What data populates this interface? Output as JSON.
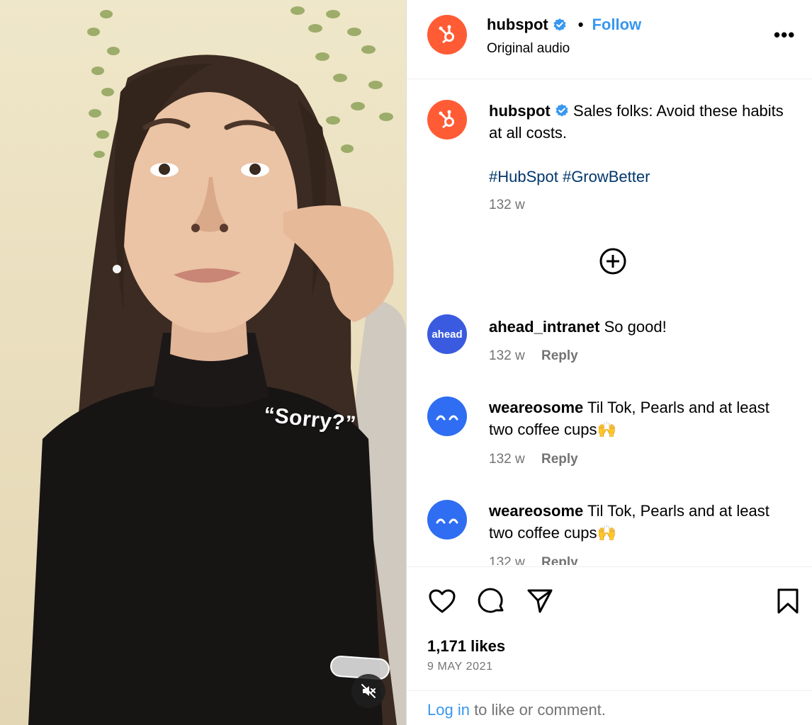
{
  "video": {
    "caption": "“Sorry?”",
    "mute_icon": "speaker-muted-icon"
  },
  "header": {
    "username": "hubspot",
    "verified_icon": "verified-badge-icon",
    "separator": "•",
    "follow_label": "Follow",
    "audio": "Original audio",
    "more_icon": "more-options-icon",
    "more_glyph": "•••"
  },
  "post": {
    "username": "hubspot",
    "caption": "Sales folks: Avoid these habits at all costs.",
    "hashtags": "#HubSpot #GrowBetter",
    "age": "132 w"
  },
  "load_more_icon": "plus-circle-icon",
  "comments": [
    {
      "username": "ahead_intranet",
      "avatar_text": "ahead",
      "text": "So good!",
      "age": "132 w",
      "reply": "Reply"
    },
    {
      "username": "weareosome",
      "text": "Til Tok, Pearls and at least two coffee cups🙌",
      "age": "132 w",
      "reply": "Reply"
    },
    {
      "username": "weareosome",
      "text": "Til Tok, Pearls and at least two coffee cups🙌",
      "age": "132 w",
      "reply": "Reply"
    }
  ],
  "actions": {
    "like_icon": "heart-icon",
    "comment_icon": "comment-icon",
    "share_icon": "send-icon",
    "save_icon": "bookmark-icon"
  },
  "likes": "1,171 likes",
  "date": "9 MAY 2021",
  "login": {
    "link": "Log in",
    "rest": " to like or comment."
  },
  "colors": {
    "accent": "#3897f0",
    "hubspot_orange": "#ff5c35",
    "hashtag": "#00376b",
    "muted": "#737373"
  }
}
